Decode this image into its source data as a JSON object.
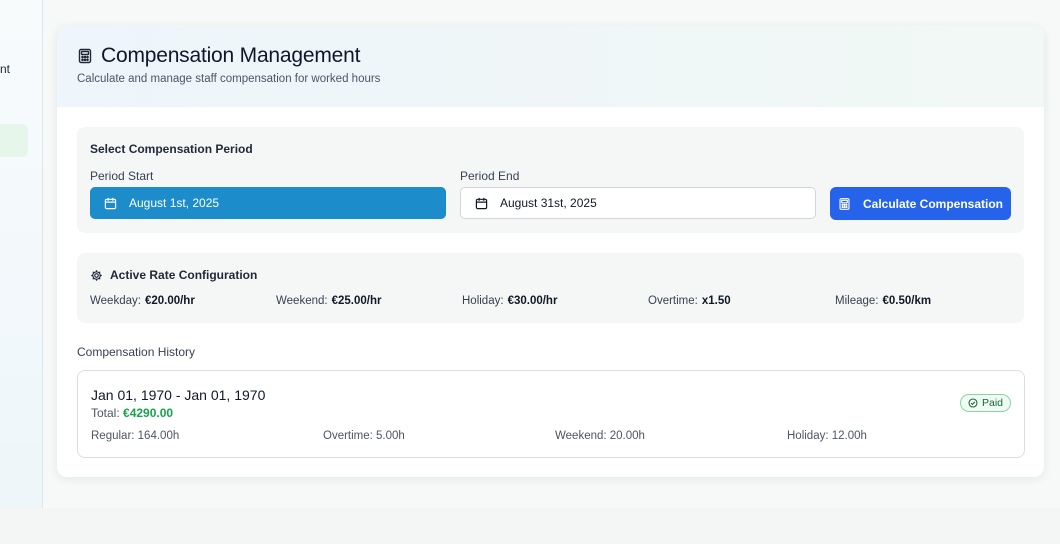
{
  "sidebar": {
    "nav_fragment": "nt"
  },
  "header": {
    "title": "Compensation Management",
    "subtitle": "Calculate and manage staff compensation for worked hours"
  },
  "period": {
    "heading": "Select Compensation Period",
    "start_label": "Period Start",
    "start_value": "August 1st, 2025",
    "end_label": "Period End",
    "end_value": "August 31st, 2025",
    "calculate_label": "Calculate Compensation"
  },
  "rates": {
    "heading": "Active Rate Configuration",
    "items": [
      {
        "label": "Weekday:",
        "value": "€20.00/hr"
      },
      {
        "label": "Weekend:",
        "value": "€25.00/hr"
      },
      {
        "label": "Holiday:",
        "value": "€30.00/hr"
      },
      {
        "label": "Overtime:",
        "value": "x1.50"
      },
      {
        "label": "Mileage:",
        "value": "€0.50/km"
      }
    ]
  },
  "history": {
    "heading": "Compensation History",
    "records": [
      {
        "range": "Jan 01, 1970 - Jan 01, 1970",
        "total_label": "Total:",
        "total_value": "€4290.00",
        "status": "Paid",
        "regular": "Regular: 164.00h",
        "overtime": "Overtime: 5.00h",
        "weekend": "Weekend: 20.00h",
        "holiday": "Holiday: 12.00h"
      }
    ]
  },
  "colors": {
    "accent_blue": "#1c8cca",
    "primary_button": "#2563eb",
    "success_green": "#16a34a"
  },
  "icons": {
    "title": "calculator-icon",
    "date": "calendar-icon",
    "rates": "gear-icon",
    "status": "check-circle-icon"
  }
}
